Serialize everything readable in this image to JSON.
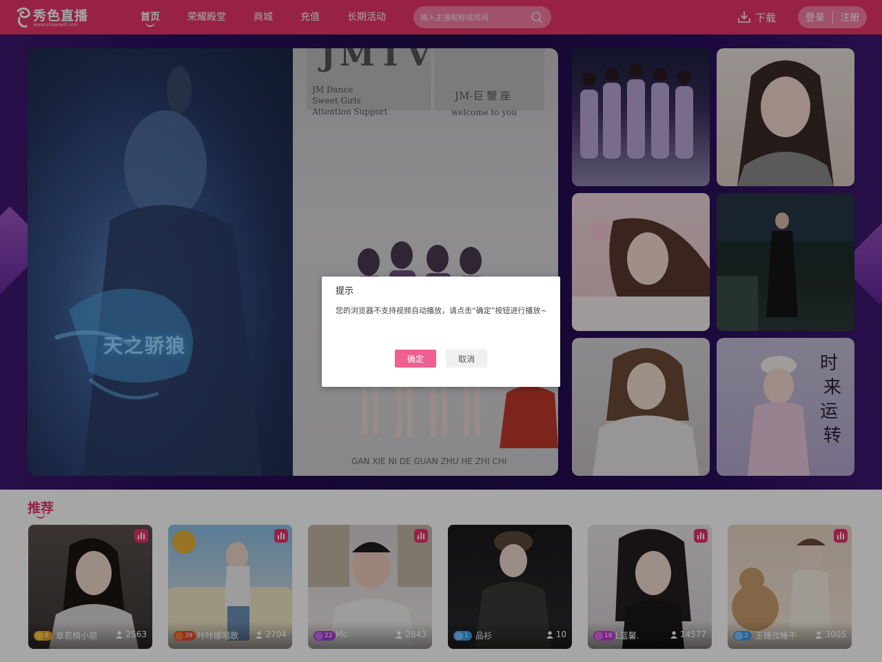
{
  "header": {
    "logo_text": "秀色直播",
    "logo_sub": "www.showself.com",
    "nav": [
      {
        "label": "首页",
        "active": true
      },
      {
        "label": "荣耀殿堂",
        "active": false
      },
      {
        "label": "商城",
        "active": false
      },
      {
        "label": "充值",
        "active": false
      },
      {
        "label": "长期活动",
        "active": false
      }
    ],
    "search_placeholder": "输入主播昵称或房间",
    "download_label": "下载",
    "login_label": "登录",
    "register_label": "注册"
  },
  "banner": {
    "video_right": {
      "big_text": "JMTV",
      "left_sign": "JM Dance\nSweet Girls\nAttention Support",
      "title": "JM-巨 蟹 座",
      "welcome": "welcome to you",
      "caption": "GAN XIE NI DE GUAN ZHU HE ZHI CHI"
    },
    "video_left_text": "天之骄狼"
  },
  "recommend": {
    "title": "推荐",
    "cards": [
      {
        "level": "8",
        "name": "章若楠小朋",
        "viewers": "2563",
        "badge_color": "#e6a21e"
      },
      {
        "level": "39",
        "name": "咔咔娜唱歌",
        "viewers": "2704",
        "badge_color": "#e84b2d"
      },
      {
        "level": "22",
        "name": "Mc",
        "viewers": "2843",
        "badge_color": "#a83bd6"
      },
      {
        "level": "1",
        "name": "品衫",
        "viewers": "10",
        "badge_color": "#3a9be8"
      },
      {
        "level": "18",
        "name": "L蓝馨.",
        "viewers": "14577",
        "badge_color": "#c03bd6"
      },
      {
        "level": "2",
        "name": "王穗孜睡不",
        "viewers": "3005",
        "badge_color": "#3a9be8"
      }
    ]
  },
  "dialog": {
    "title": "提示",
    "message": "您的浏览器不支持视频自动播放，请点击“确定”按钮进行播放~",
    "ok_label": "确定",
    "cancel_label": "取消"
  },
  "colors": {
    "brand": "#e8356a",
    "banner_bg": "#2a0f5e",
    "ok_button": "#ef5f8f"
  }
}
